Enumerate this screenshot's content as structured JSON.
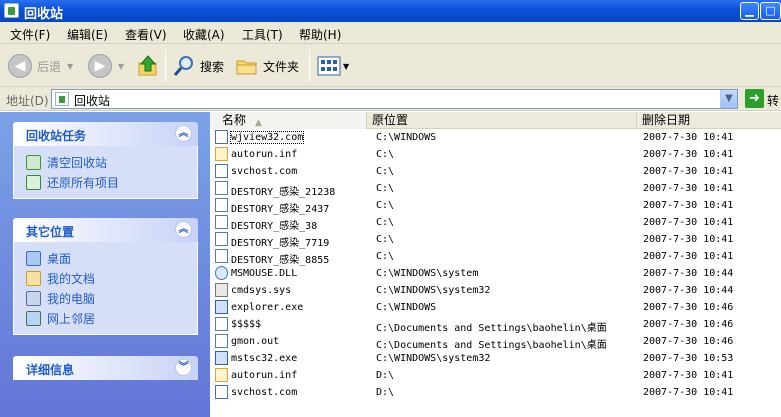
{
  "window": {
    "title": "回收站"
  },
  "menu": [
    "文件(F)",
    "编辑(E)",
    "查看(V)",
    "收藏(A)",
    "工具(T)",
    "帮助(H)"
  ],
  "toolbar": {
    "back": "后退",
    "search": "搜索",
    "folders": "文件夹"
  },
  "address": {
    "label": "地址(D)",
    "value": "回收站",
    "go": "转到"
  },
  "sidebar": {
    "tasks": {
      "title": "回收站任务",
      "items": [
        "清空回收站",
        "还原所有项目"
      ]
    },
    "places": {
      "title": "其它位置",
      "items": [
        "桌面",
        "我的文档",
        "我的电脑",
        "网上邻居"
      ]
    },
    "details": {
      "title": "详细信息"
    }
  },
  "columns": {
    "name": "名称",
    "location": "原位置",
    "date": "删除日期"
  },
  "files": [
    {
      "name": "wjview32.com",
      "location": "C:\\WINDOWS",
      "date": "2007-7-30 10:41",
      "icon": "program-icon"
    },
    {
      "name": "autorun.inf",
      "location": "C:\\",
      "date": "2007-7-30 10:41",
      "icon": "setup-info-icon"
    },
    {
      "name": "svchost.com",
      "location": "C:\\",
      "date": "2007-7-30 10:41",
      "icon": "program-icon"
    },
    {
      "name": "DESTORY_感染_21238",
      "location": "C:\\",
      "date": "2007-7-30 10:41",
      "icon": "file-icon"
    },
    {
      "name": "DESTORY_感染_2437",
      "location": "C:\\",
      "date": "2007-7-30 10:41",
      "icon": "file-icon"
    },
    {
      "name": "DESTORY_感染_38",
      "location": "C:\\",
      "date": "2007-7-30 10:41",
      "icon": "file-icon"
    },
    {
      "name": "DESTORY_感染_7719",
      "location": "C:\\",
      "date": "2007-7-30 10:41",
      "icon": "file-icon"
    },
    {
      "name": "DESTORY_感染_8855",
      "location": "C:\\",
      "date": "2007-7-30 10:41",
      "icon": "file-icon"
    },
    {
      "name": "MSMOUSE.DLL",
      "location": "C:\\WINDOWS\\system",
      "date": "2007-7-30 10:44",
      "icon": "dll-icon"
    },
    {
      "name": "cmdsys.sys",
      "location": "C:\\WINDOWS\\system32",
      "date": "2007-7-30 10:44",
      "icon": "system-file-icon"
    },
    {
      "name": "explorer.exe",
      "location": "C:\\WINDOWS",
      "date": "2007-7-30 10:46",
      "icon": "exe-icon"
    },
    {
      "name": "$$$$$",
      "location": "C:\\Documents and Settings\\baohelin\\桌面",
      "date": "2007-7-30 10:46",
      "icon": "file-icon"
    },
    {
      "name": "gmon.out",
      "location": "C:\\Documents and Settings\\baohelin\\桌面",
      "date": "2007-7-30 10:46",
      "icon": "file-icon"
    },
    {
      "name": "mstsc32.exe",
      "location": "C:\\WINDOWS\\system32",
      "date": "2007-7-30 10:53",
      "icon": "exe-icon"
    },
    {
      "name": "autorun.inf",
      "location": "D:\\",
      "date": "2007-7-30 10:41",
      "icon": "setup-info-icon"
    },
    {
      "name": "svchost.com",
      "location": "D:\\",
      "date": "2007-7-30 10:41",
      "icon": "program-icon"
    }
  ],
  "colors": {
    "titlebar": "#0a4ed8",
    "sidebar": "#7ba2e7",
    "link": "#215dc6"
  }
}
